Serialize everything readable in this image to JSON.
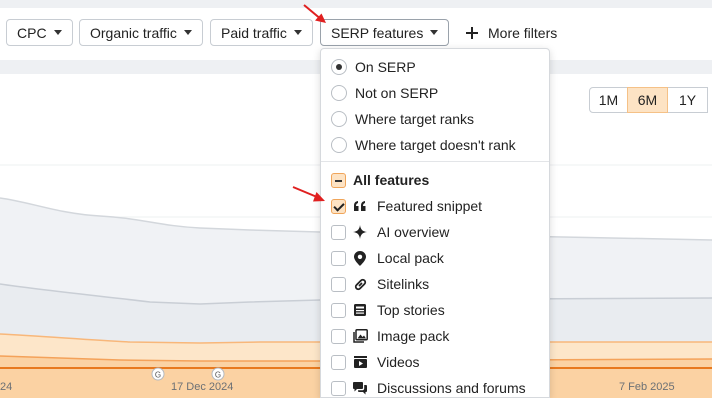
{
  "filters": {
    "cpc": "CPC",
    "organic_traffic": "Organic traffic",
    "paid_traffic": "Paid traffic",
    "serp_features": "SERP features",
    "more_filters": "More filters"
  },
  "range_buttons": [
    "1M",
    "6M",
    "1Y"
  ],
  "selected_range": "6M",
  "x_axis_labels": [
    "24",
    "17 Dec 2024",
    "7 Feb 2025"
  ],
  "event_markers": [
    "G",
    "G"
  ],
  "dropdown": {
    "serp_presence": [
      {
        "label": "On SERP",
        "selected": true
      },
      {
        "label": "Not on SERP",
        "selected": false
      },
      {
        "label": "Where target ranks",
        "selected": false
      },
      {
        "label": "Where target doesn't rank",
        "selected": false
      }
    ],
    "all_features_label": "All features",
    "features": [
      {
        "label": "Featured snippet",
        "icon": "quote-icon",
        "checked": true
      },
      {
        "label": "AI overview",
        "icon": "sparkle-icon",
        "checked": false
      },
      {
        "label": "Local pack",
        "icon": "map-pin-icon",
        "checked": false
      },
      {
        "label": "Sitelinks",
        "icon": "link-icon",
        "checked": false
      },
      {
        "label": "Top stories",
        "icon": "newspaper-icon",
        "checked": false
      },
      {
        "label": "Image pack",
        "icon": "image-icon",
        "checked": false
      },
      {
        "label": "Videos",
        "icon": "video-icon",
        "checked": false
      },
      {
        "label": "Discussions and forums",
        "icon": "chat-icon",
        "checked": false
      }
    ]
  },
  "colors": {
    "accent": "#fde3c4",
    "accent_border": "#f0a55a",
    "annotation_arrow": "#e02020",
    "orange_area": "#fcd9ad",
    "orange_line": "#f59a3c",
    "gray_area": "#e8ebef",
    "gray_line": "#c9ced5"
  }
}
